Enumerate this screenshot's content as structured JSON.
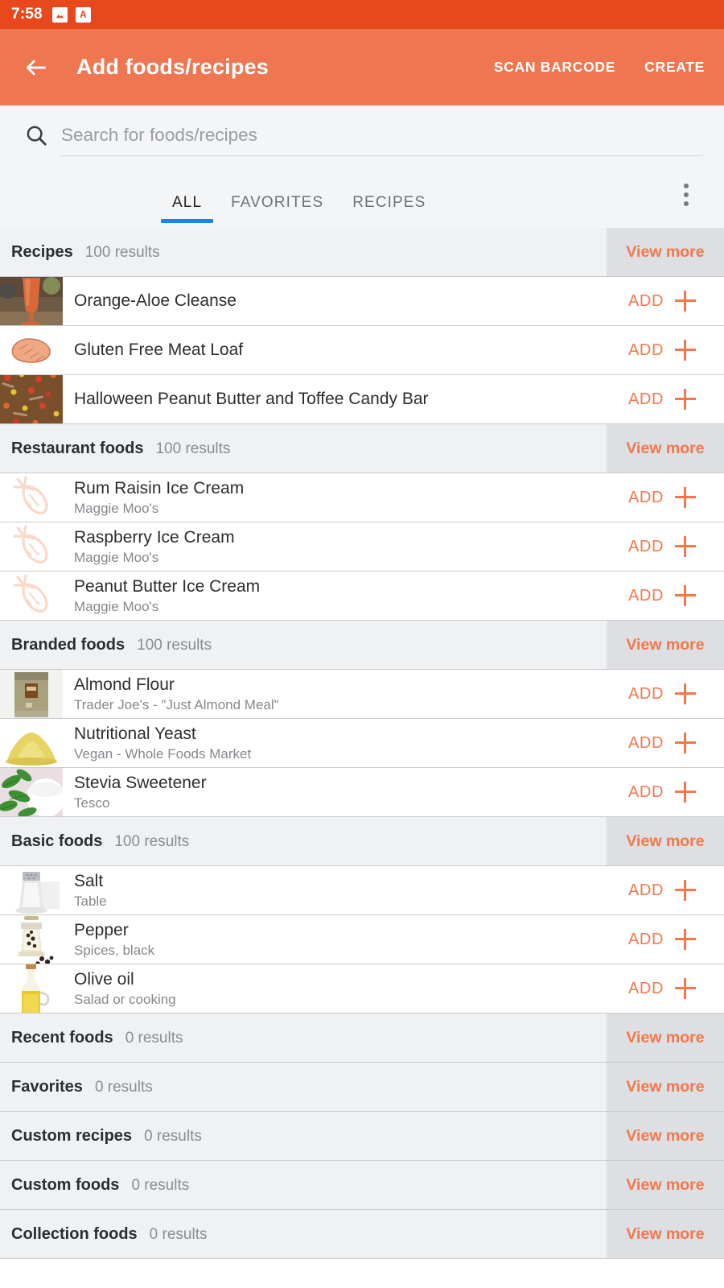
{
  "status_bar": {
    "time": "7:58",
    "icons": [
      {
        "name": "image-icon",
        "glyph": "image"
      },
      {
        "name": "letter-a-icon",
        "glyph": "A"
      }
    ],
    "background": "#E8491C"
  },
  "app_bar": {
    "back_icon": "back-arrow-icon",
    "title": "Add foods/recipes",
    "actions": [
      {
        "name": "scan-barcode-action",
        "label": "SCAN BARCODE"
      },
      {
        "name": "create-action",
        "label": "CREATE"
      }
    ],
    "background": "#EE7752"
  },
  "search": {
    "icon": "search-icon",
    "value": "",
    "placeholder": "Search for foods/recipes"
  },
  "tabs": {
    "items": [
      {
        "name": "tab-all",
        "label": "ALL",
        "active": true
      },
      {
        "name": "tab-favorites",
        "label": "FAVORITES",
        "active": false
      },
      {
        "name": "tab-recipes",
        "label": "RECIPES",
        "active": false
      }
    ],
    "indicator_color": "#2085DE",
    "overflow_icon": "kebab-menu-icon"
  },
  "common": {
    "view_more_label": "View more",
    "add_label": "ADD",
    "add_icon": "plus-icon",
    "accent_color": "#F4774B"
  },
  "sections": [
    {
      "name": "recipes",
      "title": "Recipes",
      "count": "100 results",
      "view_more": "View more",
      "items": [
        {
          "title": "Orange-Aloe Cleanse",
          "subtitle": "",
          "thumb": "photo-smoothie-glass"
        },
        {
          "title": "Gluten Free Meat Loaf",
          "subtitle": "",
          "thumb": "illustration-meat-loaf"
        },
        {
          "title": "Halloween Peanut Butter and Toffee Candy Bar",
          "subtitle": "",
          "thumb": "photo-candy-bar"
        }
      ]
    },
    {
      "name": "restaurant-foods",
      "title": "Restaurant foods",
      "count": "100 results",
      "view_more": "View more",
      "items": [
        {
          "title": "Rum Raisin Ice Cream",
          "subtitle": "Maggie Moo's",
          "thumb": "carrot-placeholder-icon"
        },
        {
          "title": "Raspberry Ice Cream",
          "subtitle": "Maggie Moo's",
          "thumb": "carrot-placeholder-icon"
        },
        {
          "title": "Peanut Butter Ice Cream",
          "subtitle": "Maggie Moo's",
          "thumb": "carrot-placeholder-icon"
        }
      ]
    },
    {
      "name": "branded-foods",
      "title": "Branded foods",
      "count": "100 results",
      "view_more": "View more",
      "items": [
        {
          "title": "Almond Flour",
          "subtitle": "Trader Joe's - \"Just Almond Meal\"",
          "thumb": "photo-almond-flour-bag"
        },
        {
          "title": "Nutritional Yeast",
          "subtitle": "Vegan - Whole Foods Market",
          "thumb": "photo-yellow-powder-pile"
        },
        {
          "title": "Stevia Sweetener",
          "subtitle": "Tesco",
          "thumb": "photo-stevia-leaves-bowl"
        }
      ]
    },
    {
      "name": "basic-foods",
      "title": "Basic foods",
      "count": "100 results",
      "view_more": "View more",
      "items": [
        {
          "title": "Salt",
          "subtitle": "Table",
          "thumb": "photo-salt-shaker"
        },
        {
          "title": "Pepper",
          "subtitle": "Spices, black",
          "thumb": "photo-pepper-grinder"
        },
        {
          "title": "Olive oil",
          "subtitle": "Salad or cooking",
          "thumb": "photo-olive-oil-bottle"
        }
      ]
    },
    {
      "name": "recent-foods",
      "title": "Recent foods",
      "count": "0 results",
      "view_more": "View more",
      "items": []
    },
    {
      "name": "favorites",
      "title": "Favorites",
      "count": "0 results",
      "view_more": "View more",
      "items": []
    },
    {
      "name": "custom-recipes",
      "title": "Custom recipes",
      "count": "0 results",
      "view_more": "View more",
      "items": []
    },
    {
      "name": "custom-foods",
      "title": "Custom foods",
      "count": "0 results",
      "view_more": "View more",
      "items": []
    },
    {
      "name": "collection-foods",
      "title": "Collection foods",
      "count": "0 results",
      "view_more": "View more",
      "items": []
    }
  ]
}
